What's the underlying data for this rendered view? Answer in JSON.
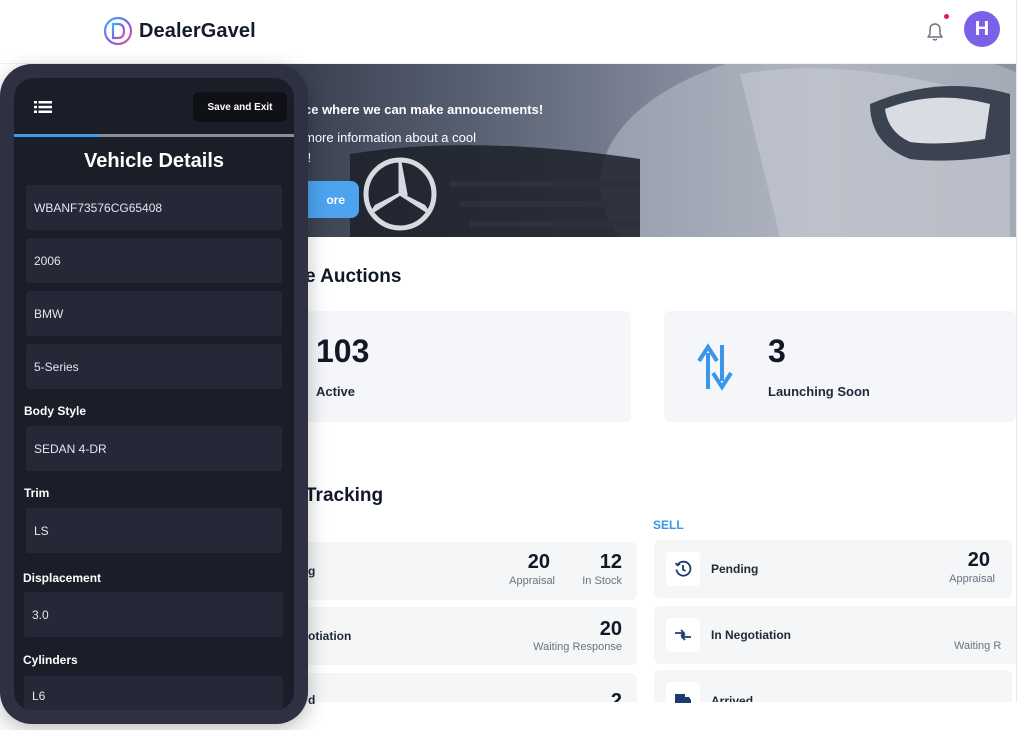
{
  "header": {
    "brand": "DealerGavel",
    "avatar_initial": "H",
    "notification_dot": true
  },
  "hero": {
    "title": "ce where we can make annoucements!",
    "subtitle_line1": "more information about a cool",
    "subtitle_line2": "t!",
    "button_label": "ore"
  },
  "auctions": {
    "section_title": "e Auctions",
    "cards": [
      {
        "value": "103",
        "label": "Active"
      },
      {
        "value": "3",
        "label": "Launching Soon"
      }
    ]
  },
  "tracking": {
    "section_title": "Tracking",
    "sell_label": "SELL",
    "buy_rows": [
      {
        "label": "g",
        "values": [
          {
            "num": "20",
            "sub": "Appraisal"
          },
          {
            "num": "12",
            "sub": "In Stock"
          }
        ]
      },
      {
        "label": "otiation",
        "values": [
          {
            "num": "20",
            "sub": "Waiting Response"
          }
        ]
      },
      {
        "label": "d",
        "values": [
          {
            "num": "2",
            "sub": ""
          }
        ]
      }
    ],
    "sell_rows": [
      {
        "label": "Pending",
        "icon": "clock-icon",
        "num": "20",
        "sub": "Appraisal"
      },
      {
        "label": "In Negotiation",
        "icon": "exchange-arrows-icon",
        "num": "",
        "sub": "Waiting R"
      },
      {
        "label": "Arrived",
        "icon": "truck-icon",
        "num": "",
        "sub": ""
      }
    ]
  },
  "phone": {
    "save_button": "Save and Exit",
    "progress_percent": 30,
    "title": "Vehicle Details",
    "fields": {
      "vin": "WBANF73576CG65408",
      "year": "2006",
      "make": "BMW",
      "model": "5-Series",
      "body_style_label": "Body Style",
      "body_style": "SEDAN 4-DR",
      "trim_label": "Trim",
      "trim": "LS",
      "displacement_label": "Displacement",
      "displacement": "3.0",
      "cylinders_label": "Cylinders",
      "cylinders": "L6"
    }
  },
  "colors": {
    "accent": "#3b9bee",
    "avatar": "#7b61e8",
    "phone_frame": "#2d3142",
    "phone_screen": "#1b1d28"
  }
}
